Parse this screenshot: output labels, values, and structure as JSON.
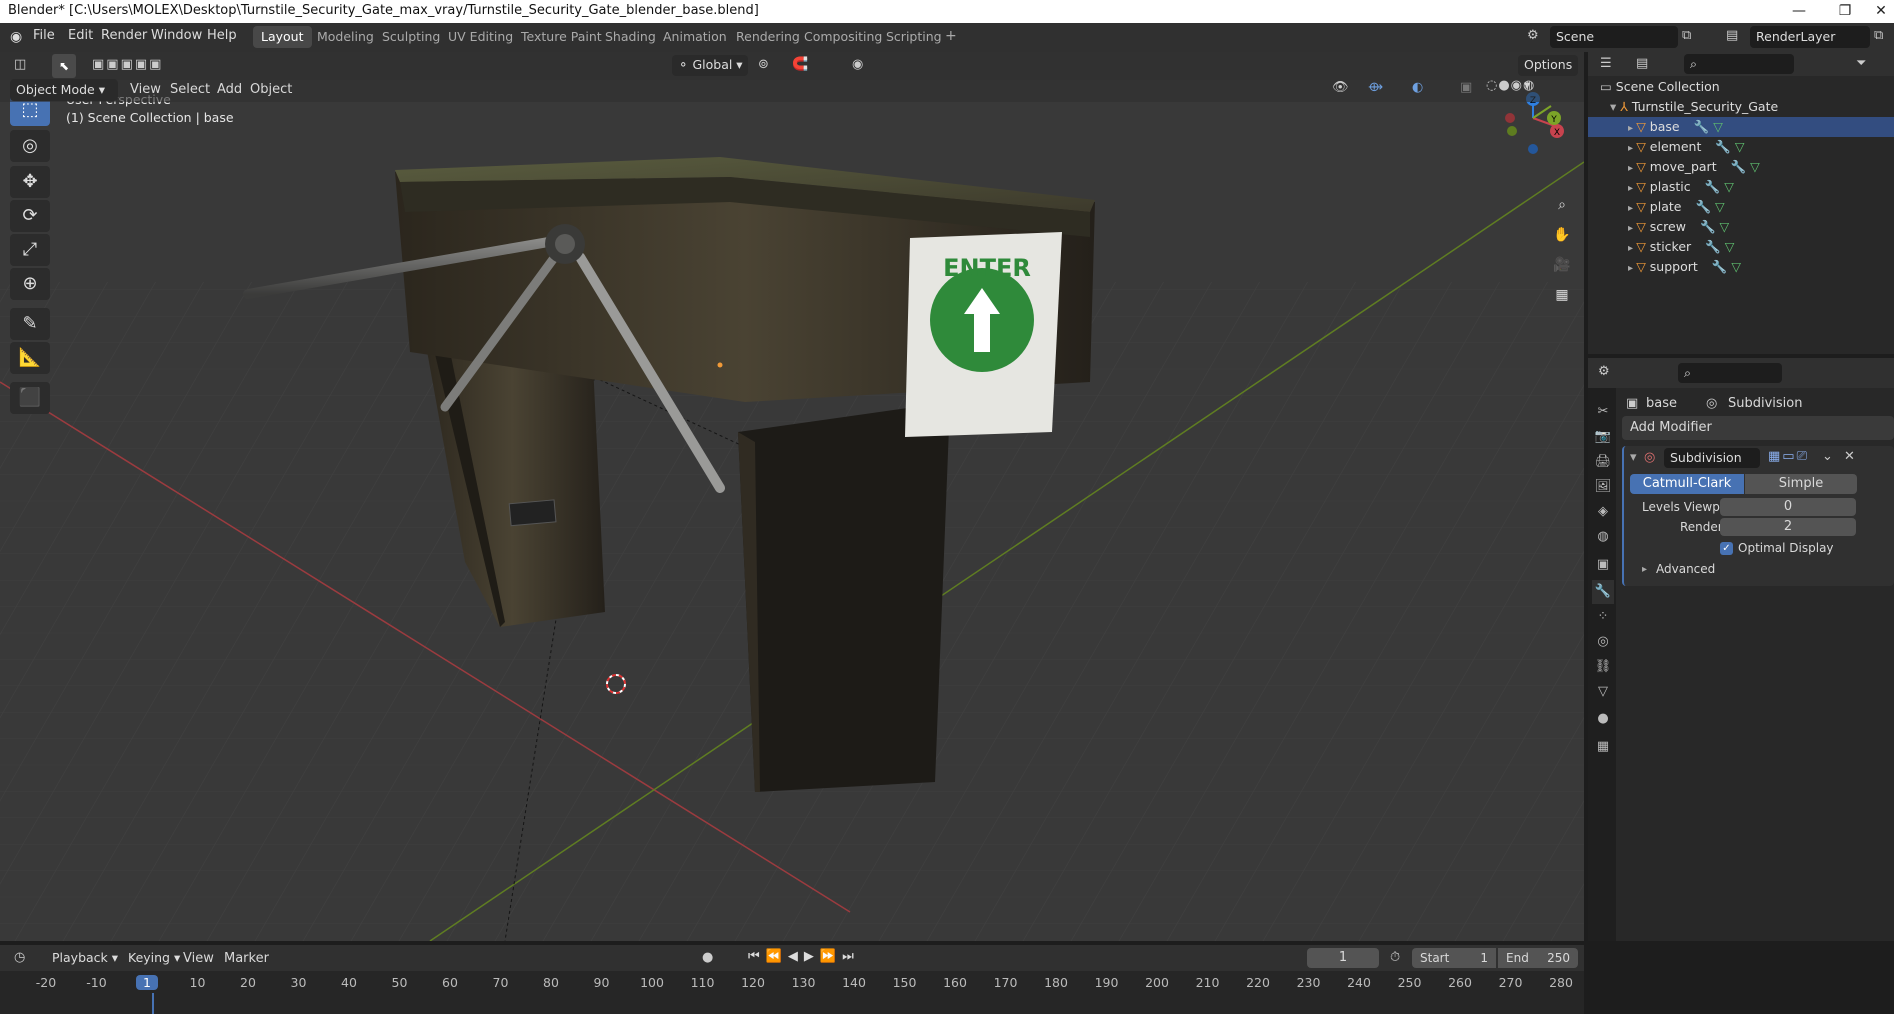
{
  "titlebar": {
    "title": "Blender* [C:\\Users\\MOLEX\\Desktop\\Turnstile_Security_Gate_max_vray/Turnstile_Security_Gate_blender_base.blend]",
    "minimize": "—",
    "restore": "❐",
    "close": "✕"
  },
  "menus": [
    "File",
    "Edit",
    "Render",
    "Window",
    "Help"
  ],
  "workspaces": [
    "Layout",
    "Modeling",
    "Sculpting",
    "UV Editing",
    "Texture Paint",
    "Shading",
    "Animation",
    "Rendering",
    "Compositing",
    "Scripting"
  ],
  "add_workspace": "+",
  "scene": {
    "label": "Scene",
    "render_layer": "RenderLayer"
  },
  "viewport_header": {
    "mode": "Object Mode",
    "menus": [
      "View",
      "Select",
      "Add",
      "Object"
    ],
    "transform": "Global",
    "options": "Options"
  },
  "viewport": {
    "perspective": "User Perspective",
    "collection": "(1) Scene Collection | base",
    "sign_text": "ENTER",
    "axis_x": "X",
    "axis_y": "Y",
    "axis_z": "Z",
    "colors": {
      "x_axis": "#c8434e",
      "y_axis": "#7ca428",
      "z_axis": "#2f7fe0",
      "sign_green": "#2f8a3a"
    }
  },
  "tools": [
    "select-box",
    "cursor",
    "move",
    "rotate",
    "scale",
    "transform",
    "annotate",
    "measure",
    "add-cube"
  ],
  "outliner": {
    "root": "Scene Collection",
    "collection": "Turnstile_Security_Gate",
    "objects": [
      "base",
      "element",
      "move_part",
      "plastic",
      "plate",
      "screw",
      "sticker",
      "support"
    ]
  },
  "properties": {
    "object": "base",
    "modifier_context": "Subdivision",
    "add_modifier": "Add Modifier",
    "modifier_name": "Subdivision",
    "type_a": "Catmull-Clark",
    "type_b": "Simple",
    "levels_viewport_label": "Levels Viewport",
    "levels_viewport": "0",
    "render_label": "Render",
    "render": "2",
    "optimal_display": "Optimal Display",
    "advanced": "Advanced"
  },
  "timeline": {
    "menus": [
      "Playback",
      "Keying",
      "View",
      "Marker"
    ],
    "current_frame": "1",
    "start_label": "Start",
    "start": "1",
    "end_label": "End",
    "end": "250",
    "ticks": [
      "-20",
      "-10",
      "1",
      "10",
      "20",
      "30",
      "40",
      "50",
      "60",
      "70",
      "80",
      "90",
      "100",
      "110",
      "120",
      "130",
      "140",
      "150",
      "160",
      "170",
      "180",
      "190",
      "200",
      "210",
      "220",
      "230",
      "240",
      "250",
      "260",
      "270",
      "280"
    ]
  }
}
